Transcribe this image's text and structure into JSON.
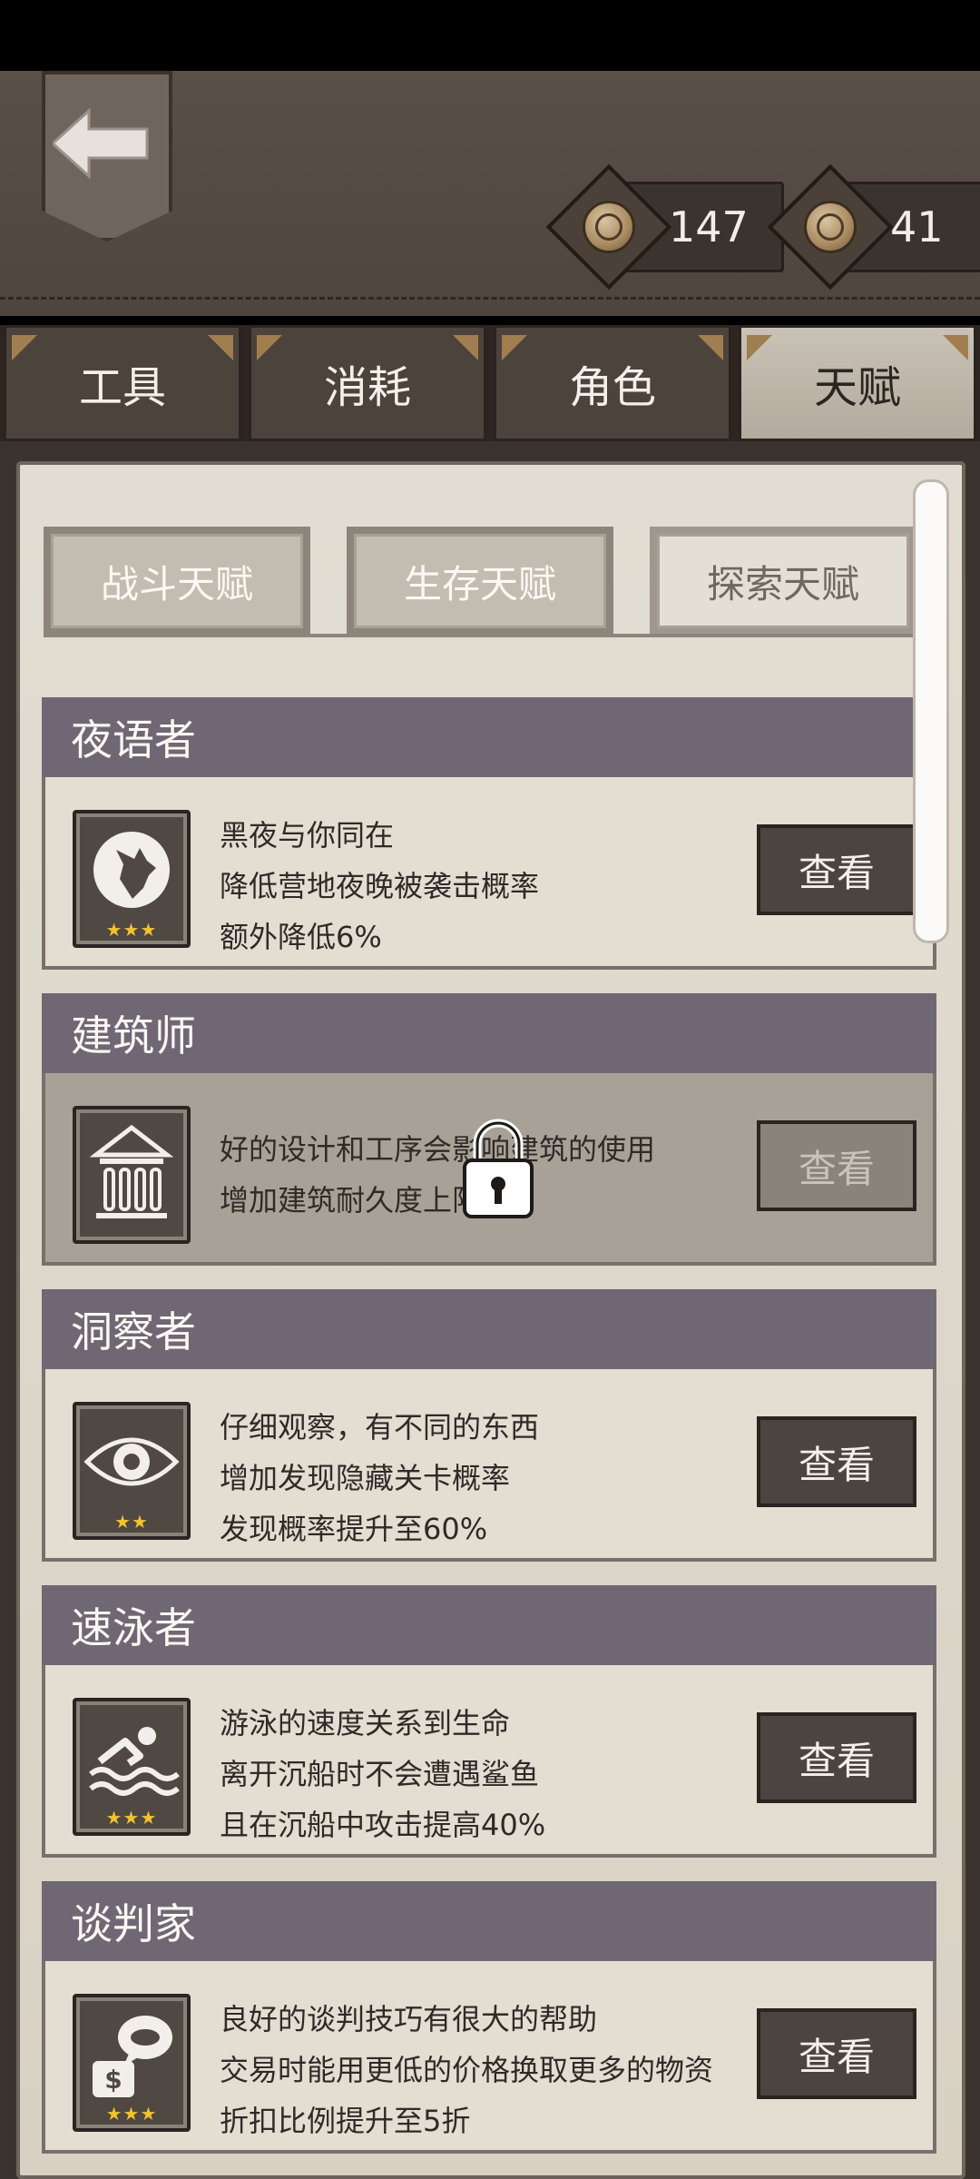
{
  "currency": [
    {
      "icon": "coin-icon",
      "value": "147"
    },
    {
      "icon": "coin-icon",
      "value": "41"
    }
  ],
  "tabs": [
    {
      "label": "工具",
      "active": false
    },
    {
      "label": "消耗",
      "active": false
    },
    {
      "label": "角色",
      "active": false
    },
    {
      "label": "天赋",
      "active": true
    }
  ],
  "subtabs": [
    {
      "label": "战斗天赋",
      "active": false
    },
    {
      "label": "生存天赋",
      "active": false
    },
    {
      "label": "探索天赋",
      "active": true
    }
  ],
  "talents": [
    {
      "title": "夜语者",
      "icon": "wolf-icon",
      "stars": "★★★",
      "lines": [
        "黑夜与你同在",
        "降低营地夜晚被袭击概率",
        "额外降低6%"
      ],
      "button": "查看",
      "locked": false
    },
    {
      "title": "建筑师",
      "icon": "building-icon",
      "stars": "",
      "lines": [
        "好的设计和工序会影响建筑的使用",
        "增加建筑耐久度上限"
      ],
      "button": "查看",
      "locked": true
    },
    {
      "title": "洞察者",
      "icon": "eye-icon",
      "stars": "★★",
      "lines": [
        "仔细观察，有不同的东西",
        "增加发现隐藏关卡概率",
        "发现概率提升至60%"
      ],
      "button": "查看",
      "locked": false
    },
    {
      "title": "速泳者",
      "icon": "swimmer-icon",
      "stars": "★★★",
      "lines": [
        "游泳的速度关系到生命",
        "离开沉船时不会遭遇鲨鱼",
        "且在沉船中攻击提高40%"
      ],
      "button": "查看",
      "locked": false
    },
    {
      "title": "谈判家",
      "icon": "negotiation-icon",
      "stars": "★★★",
      "lines": [
        "良好的谈判技巧有很大的帮助",
        "交易时能用更低的价格换取更多的物资",
        "折扣比例提升至5折"
      ],
      "button": "查看",
      "locked": false
    }
  ]
}
